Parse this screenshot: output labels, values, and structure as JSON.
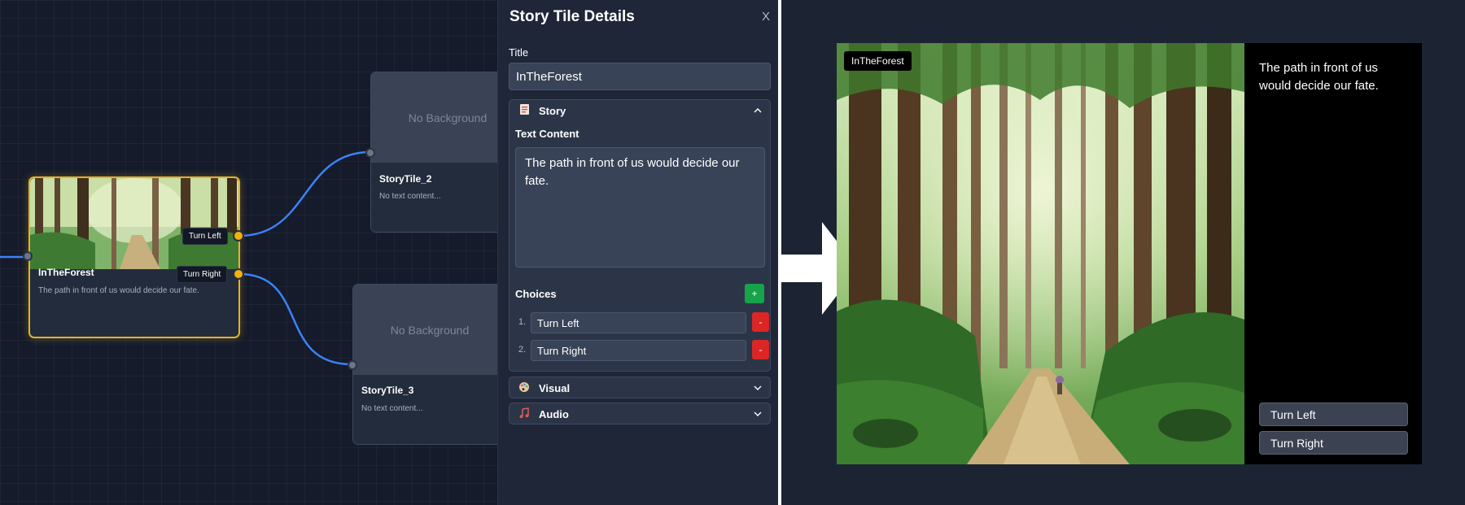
{
  "canvas": {
    "nodes": [
      {
        "title": "InTheForest",
        "text": "The path in front of us would decide our fate."
      },
      {
        "title": "StoryTile_2",
        "text": "No text content...",
        "placeholder": "No Background"
      },
      {
        "title": "StoryTile_3",
        "text": "No text content...",
        "placeholder": "No Background"
      }
    ],
    "choice_tags": [
      "Turn Left",
      "Turn Right"
    ]
  },
  "panel": {
    "title": "Story Tile Details",
    "close_label": "X",
    "title_label": "Title",
    "title_value": "InTheForest",
    "sections": {
      "story": {
        "label": "Story",
        "icon": "document-icon"
      },
      "visual": {
        "label": "Visual",
        "icon": "palette-icon"
      },
      "audio": {
        "label": "Audio",
        "icon": "music-icon"
      }
    },
    "text_content_label": "Text Content",
    "text_content": "The path in front of us would decide our fate.",
    "choices_label": "Choices",
    "add_label": "+",
    "remove_label": "-",
    "choices": [
      {
        "num": "1.",
        "value": "Turn Left"
      },
      {
        "num": "2.",
        "value": "Turn Right"
      }
    ]
  },
  "preview": {
    "title": "InTheForest",
    "text": "The path in front of us would decide our fate.",
    "choices": [
      "Turn Left",
      "Turn Right"
    ]
  },
  "colors": {
    "accent_selected": "#e5b12a",
    "edge": "#3b82f6",
    "add": "#17a34a",
    "remove": "#dc2626"
  }
}
